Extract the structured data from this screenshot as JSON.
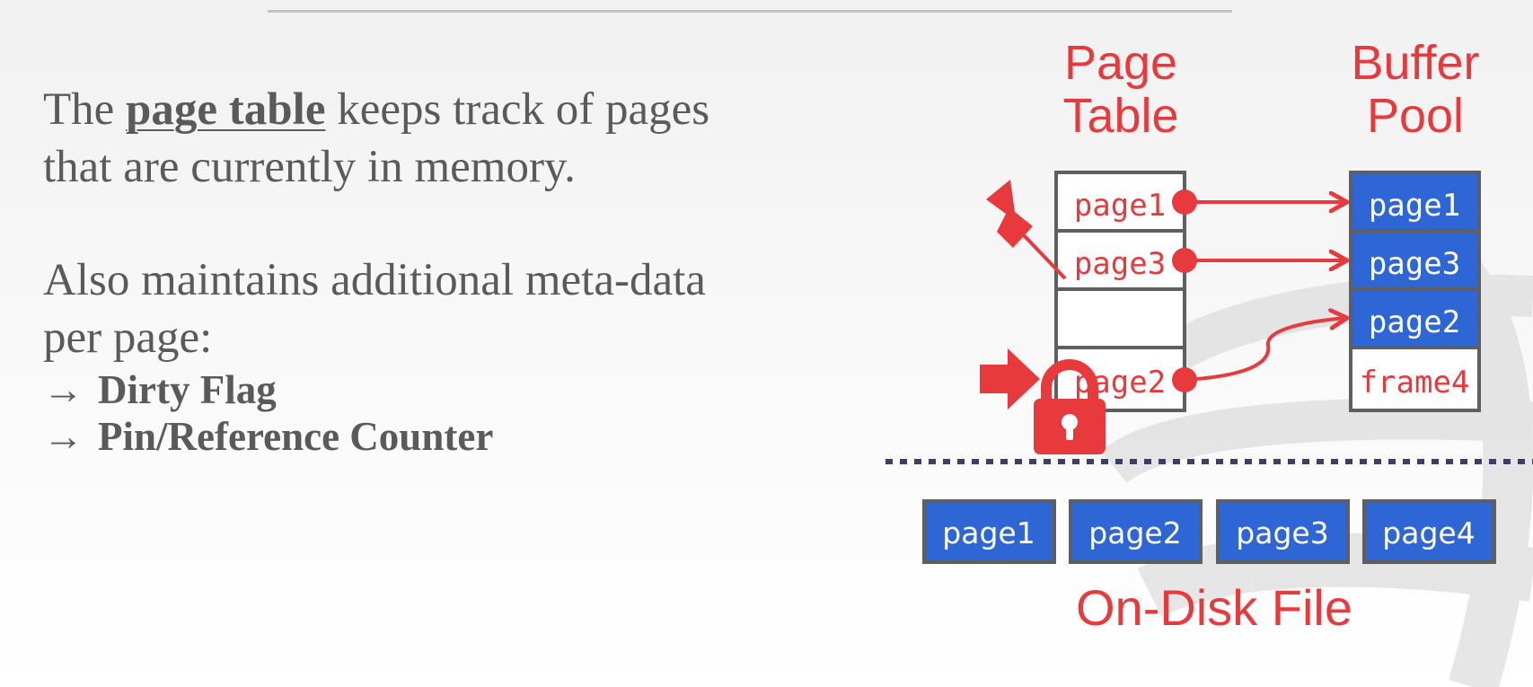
{
  "text": {
    "line1_prefix": "The ",
    "line1_term": "page table",
    "line1_suffix": " keeps track of pages",
    "line2": "that are currently in memory.",
    "para2_line1": "Also maintains additional meta-data",
    "para2_line2": "per page:",
    "bullet_arrow": "→",
    "bullets": [
      "Dirty Flag",
      "Pin/Reference Counter"
    ]
  },
  "diagram": {
    "page_table_title": [
      "Page",
      "Table"
    ],
    "buffer_pool_title": [
      "Buffer",
      "Pool"
    ],
    "page_table_rows": [
      "page1",
      "page3",
      "",
      "page2"
    ],
    "buffer_pool_frames": [
      "page1",
      "page3",
      "page2",
      "frame4"
    ],
    "disk_pages": [
      "page1",
      "page2",
      "page3",
      "page4"
    ],
    "disk_label": "On-Disk File",
    "icons": [
      "pushpin-icon",
      "arrow-right-icon",
      "lock-icon"
    ],
    "colors": {
      "accent_red": "#e8393d",
      "page_blue": "#2e66d6",
      "border_gray": "#5f5f5f",
      "text_gray": "#5a5a5a",
      "divider_navy": "#3d3d66"
    }
  }
}
